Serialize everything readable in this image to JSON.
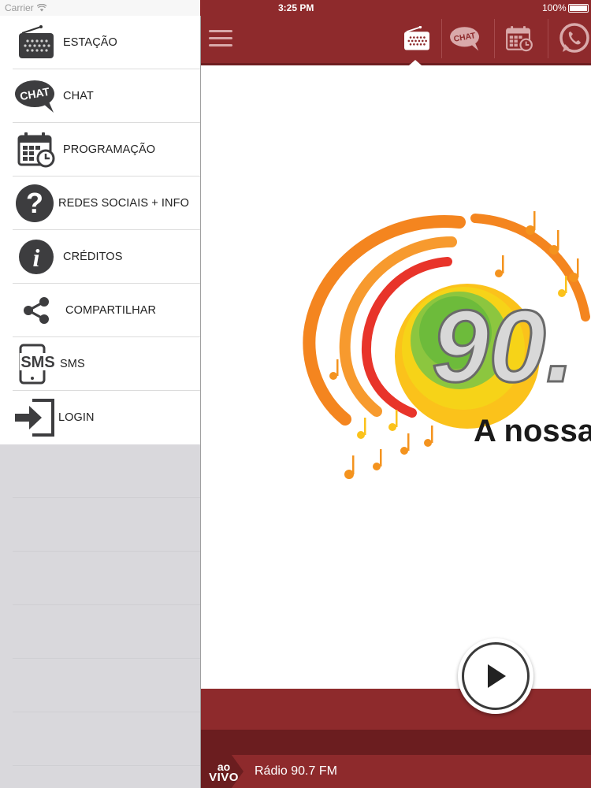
{
  "status_bar": {
    "carrier": "Carrier",
    "time": "3:25 PM",
    "battery": "100%"
  },
  "sidebar": {
    "items": [
      {
        "label": "ESTAÇÃO",
        "icon": "radio-icon"
      },
      {
        "label": "CHAT",
        "icon": "chat-bubble-icon"
      },
      {
        "label": "PROGRAMAÇÃO",
        "icon": "calendar-clock-icon"
      },
      {
        "label": "REDES SOCIAIS + INFO",
        "icon": "question-icon"
      },
      {
        "label": "CRÉDITOS",
        "icon": "info-icon"
      },
      {
        "label": "COMPARTILHAR",
        "icon": "share-icon"
      },
      {
        "label": "SMS",
        "icon": "sms-phone-icon"
      },
      {
        "label": "LOGIN",
        "icon": "login-icon"
      }
    ]
  },
  "navbar": {
    "tabs": [
      {
        "icon": "radio-icon",
        "active": true
      },
      {
        "icon": "chat-bubble-icon",
        "label": "CHAT"
      },
      {
        "icon": "calendar-clock-icon"
      },
      {
        "icon": "whatsapp-icon"
      }
    ]
  },
  "logo": {
    "big_text": "90.",
    "slogan": "A nossa"
  },
  "footer": {
    "ao": "ao",
    "vivo": "VIVO",
    "station": "Rádio 90.7 FM"
  },
  "colors": {
    "brand": "#8e2a2c",
    "brand_dark": "#6b1d1f"
  }
}
